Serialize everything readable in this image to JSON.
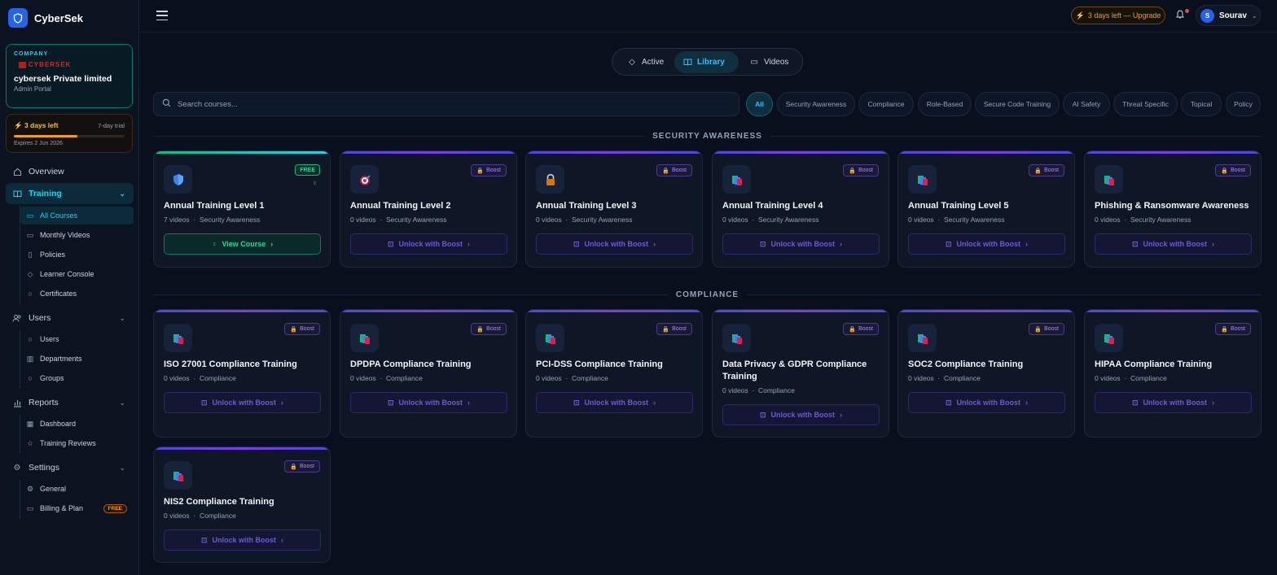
{
  "brand": {
    "name": "CyberSek"
  },
  "company": {
    "label": "COMPANY",
    "logo_text": "CYBERSEK",
    "name": "cybersek Private limited",
    "role": "Admin Portal"
  },
  "trial": {
    "days_left": "3 days left",
    "type": "7-day trial",
    "expires": "Expires 2 Jun 2026",
    "progress": 0.57
  },
  "nav": {
    "overview": "Overview",
    "training": "Training",
    "training_items": [
      "All Courses",
      "Monthly Videos",
      "Policies",
      "Learner Console",
      "Certificates"
    ],
    "users": "Users",
    "users_items": [
      "Users",
      "Departments",
      "Groups"
    ],
    "reports": "Reports",
    "reports_items": [
      "Dashboard",
      "Training Reviews"
    ],
    "settings": "Settings",
    "settings_items": [
      "General",
      "Billing & Plan"
    ],
    "billing_badge": "FREE"
  },
  "topbar": {
    "upgrade": "3 days left — Upgrade",
    "user_initial": "S",
    "user_name": "Sourav"
  },
  "tabs": [
    "Active",
    "Library",
    "Videos"
  ],
  "search": {
    "placeholder": "Search courses..."
  },
  "filters": [
    "All",
    "Security Awareness",
    "Compliance",
    "Role-Based",
    "Secure Code Training",
    "AI Safety",
    "Threat Specific",
    "Topical",
    "Policy"
  ],
  "sections": {
    "security": {
      "title": "SECURITY AWARENESS",
      "courses": [
        {
          "title": "Annual Training Level 1",
          "videos": "7 videos",
          "category": "Security Awareness",
          "badge": "FREE",
          "button": "View Course"
        },
        {
          "title": "Annual Training Level 2",
          "videos": "0 videos",
          "category": "Security Awareness",
          "badge": "Boost",
          "button": "Unlock with Boost"
        },
        {
          "title": "Annual Training Level 3",
          "videos": "0 videos",
          "category": "Security Awareness",
          "badge": "Boost",
          "button": "Unlock with Boost"
        },
        {
          "title": "Annual Training Level 4",
          "videos": "0 videos",
          "category": "Security Awareness",
          "badge": "Boost",
          "button": "Unlock with Boost"
        },
        {
          "title": "Annual Training Level 5",
          "videos": "0 videos",
          "category": "Security Awareness",
          "badge": "Boost",
          "button": "Unlock with Boost"
        },
        {
          "title": "Phishing & Ransomware Awareness",
          "videos": "0 videos",
          "category": "Security Awareness",
          "badge": "Boost",
          "button": "Unlock with Boost"
        }
      ]
    },
    "compliance": {
      "title": "COMPLIANCE",
      "courses": [
        {
          "title": "ISO 27001 Compliance Training",
          "videos": "0 videos",
          "category": "Compliance",
          "badge": "Boost",
          "button": "Unlock with Boost"
        },
        {
          "title": "DPDPA Compliance Training",
          "videos": "0 videos",
          "category": "Compliance",
          "badge": "Boost",
          "button": "Unlock with Boost"
        },
        {
          "title": "PCI-DSS Compliance Training",
          "videos": "0 videos",
          "category": "Compliance",
          "badge": "Boost",
          "button": "Unlock with Boost"
        },
        {
          "title": "Data Privacy & GDPR Compliance Training",
          "videos": "0 videos",
          "category": "Compliance",
          "badge": "Boost",
          "button": "Unlock with Boost"
        },
        {
          "title": "SOC2 Compliance Training",
          "videos": "0 videos",
          "category": "Compliance",
          "badge": "Boost",
          "button": "Unlock with Boost"
        },
        {
          "title": "HIPAA Compliance Training",
          "videos": "0 videos",
          "category": "Compliance",
          "badge": "Boost",
          "button": "Unlock with Boost"
        },
        {
          "title": "NIS2 Compliance Training",
          "videos": "0 videos",
          "category": "Compliance",
          "badge": "Boost",
          "button": "Unlock with Boost"
        }
      ]
    }
  },
  "meta_separator": "·",
  "colors": {
    "accent": "#22d3ee",
    "boost": "#7c3aed",
    "free": "#10b981",
    "warning": "#f59e0b",
    "background": "#0a0f1d"
  }
}
